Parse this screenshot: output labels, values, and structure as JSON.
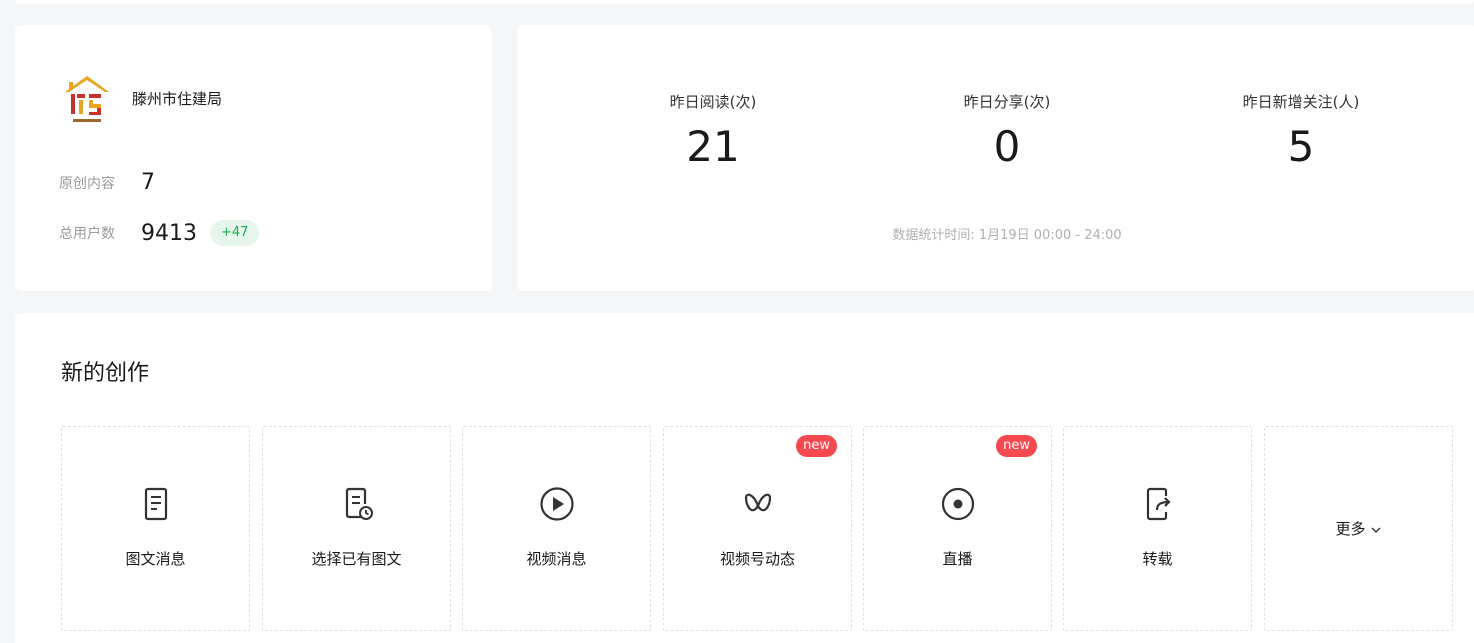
{
  "account": {
    "name": "滕州市住建局",
    "original_content_label": "原创内容",
    "original_content_value": "7",
    "total_users_label": "总用户数",
    "total_users_value": "9413",
    "total_users_delta": "+47",
    "logo_icon": "logo-image"
  },
  "stats": {
    "metrics": [
      {
        "label": "昨日阅读(次)",
        "value": "21"
      },
      {
        "label": "昨日分享(次)",
        "value": "0"
      },
      {
        "label": "昨日新增关注(人)",
        "value": "5"
      }
    ],
    "time_note": "数据统计时间: 1月19日 00:00 - 24:00"
  },
  "creation": {
    "title": "新的创作",
    "tiles": [
      {
        "label": "图文消息",
        "icon": "document-icon"
      },
      {
        "label": "选择已有图文",
        "icon": "document-clock-icon"
      },
      {
        "label": "视频消息",
        "icon": "play-circle-icon"
      },
      {
        "label": "视频号动态",
        "icon": "butterfly-icon",
        "badge": "new"
      },
      {
        "label": "直播",
        "icon": "record-icon",
        "badge": "new"
      },
      {
        "label": "转载",
        "icon": "share-document-icon"
      }
    ],
    "more_label": "更多"
  },
  "colors": {
    "accent_green": "#1aad55",
    "badge_red": "#f5484f",
    "background": "#f5f6f8"
  }
}
